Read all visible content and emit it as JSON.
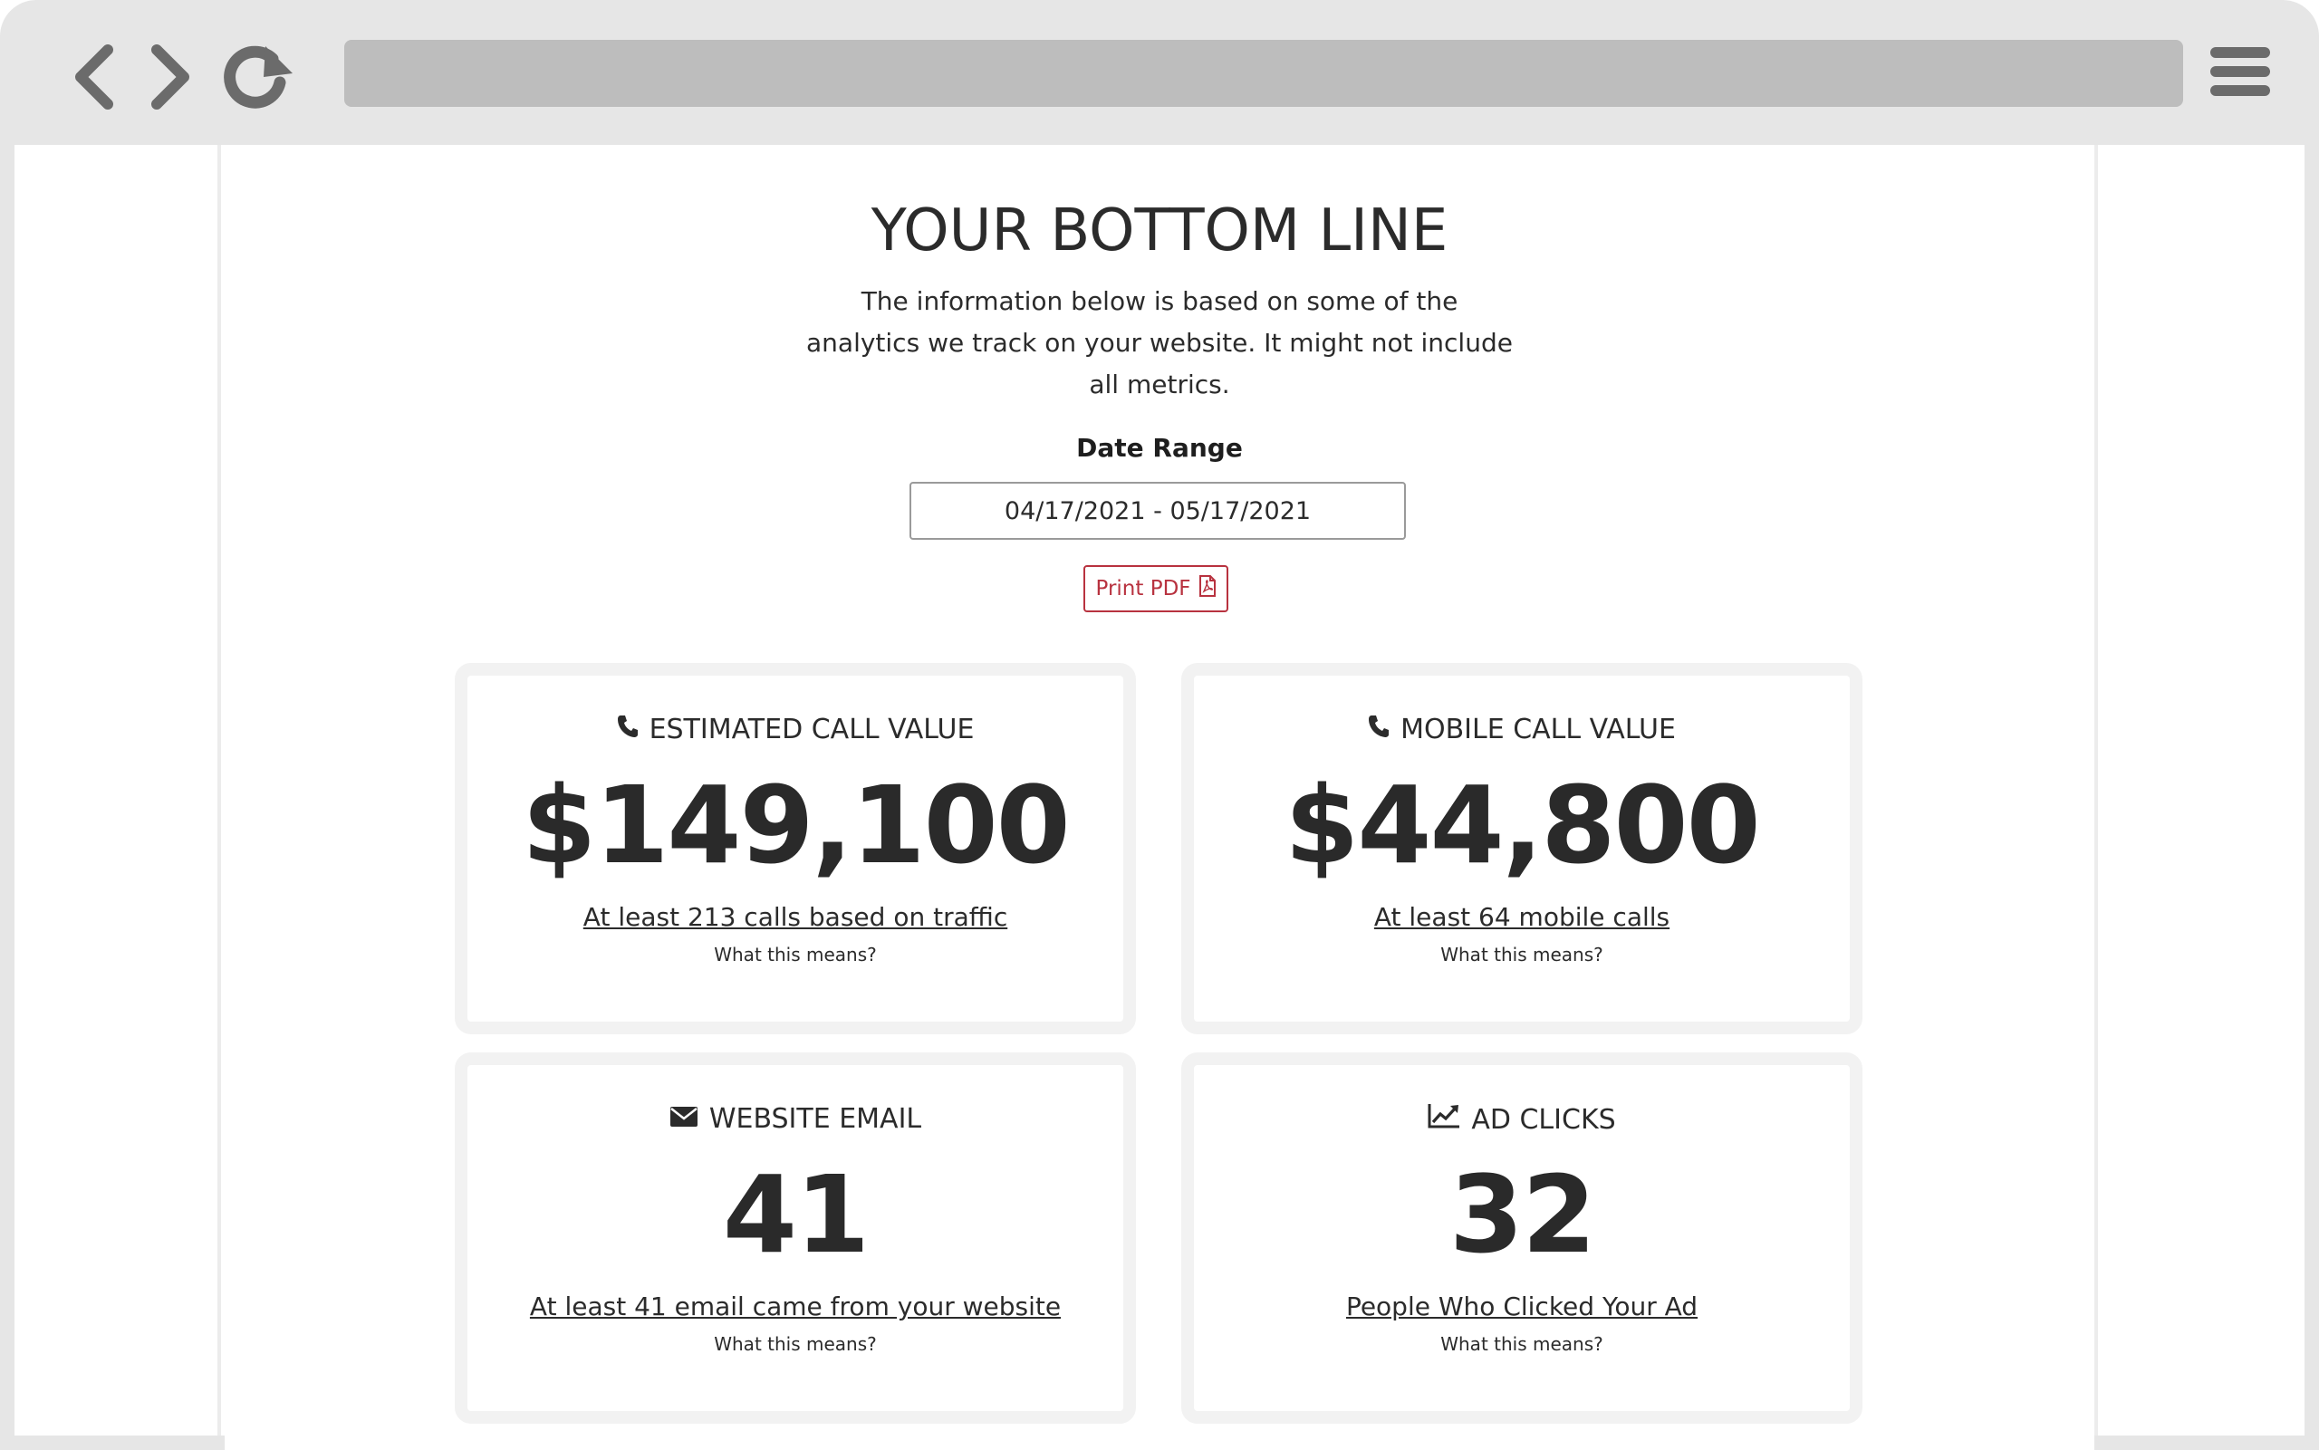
{
  "browser": {
    "back_icon": "chevron-left-icon",
    "forward_icon": "chevron-right-icon",
    "reload_icon": "reload-icon",
    "menu_icon": "hamburger-menu-icon",
    "address_value": ""
  },
  "header": {
    "title": "YOUR BOTTOM LINE",
    "intro_line1": "The information below is based on some of the",
    "intro_line2": "analytics we track on your website. It might not include",
    "intro_line3": "all metrics."
  },
  "date_range": {
    "label": "Date Range",
    "value": "04/17/2021 - 05/17/2021"
  },
  "print_button": {
    "label": "Print PDF",
    "icon": "pdf-file-icon",
    "color": "#b8323f"
  },
  "cards": [
    {
      "icon": "phone-icon",
      "title": "ESTIMATED CALL VALUE",
      "value": "$149,100",
      "link": "At least 213 calls based on traffic",
      "help": "What this means?"
    },
    {
      "icon": "phone-icon",
      "title": "MOBILE CALL VALUE",
      "value": "$44,800",
      "link": "At least 64 mobile calls",
      "help": "What this means?"
    },
    {
      "icon": "envelope-icon",
      "title": "WEBSITE EMAIL",
      "value": "41",
      "link": "At least 41 email came from your website",
      "help": "What this means?"
    },
    {
      "icon": "line-chart-icon",
      "title": "AD CLICKS",
      "value": "32",
      "link": "People Who Clicked Your Ad",
      "help": "What this means?"
    }
  ]
}
